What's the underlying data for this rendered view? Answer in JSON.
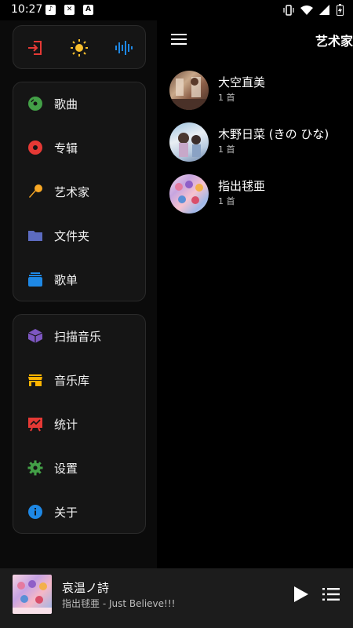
{
  "status_bar": {
    "time": "10:27",
    "left_icons": [
      "music-app-icon",
      "shield-icon",
      "alert-icon"
    ],
    "right_icons": [
      "vibrate-icon",
      "wifi-icon",
      "signal-icon",
      "battery-icon"
    ]
  },
  "drawer": {
    "top_actions": [
      {
        "name": "exit-icon",
        "color": "#e53935"
      },
      {
        "name": "sun-icon",
        "color": "#fbc02d"
      },
      {
        "name": "waveform-icon",
        "color": "#1e88e5"
      }
    ],
    "nav_items": [
      {
        "label": "歌曲",
        "icon": "disc-icon",
        "color": "#43a047"
      },
      {
        "label": "专辑",
        "icon": "album-icon",
        "color": "#e53935"
      },
      {
        "label": "艺术家",
        "icon": "microphone-icon",
        "color": "#f9a825"
      },
      {
        "label": "文件夹",
        "icon": "folder-icon",
        "color": "#5c6bc0"
      },
      {
        "label": "歌单",
        "icon": "playlist-stack-icon",
        "color": "#1e88e5"
      }
    ],
    "tool_items": [
      {
        "label": "扫描音乐",
        "icon": "scan-cube-icon",
        "color": "#7e57c2"
      },
      {
        "label": "音乐库",
        "icon": "store-icon",
        "color": "#ffb300"
      },
      {
        "label": "统计",
        "icon": "chart-board-icon",
        "color": "#e53935"
      },
      {
        "label": "设置",
        "icon": "gear-icon",
        "color": "#43a047"
      },
      {
        "label": "关于",
        "icon": "info-icon",
        "color": "#1e88e5"
      }
    ]
  },
  "main": {
    "title": "艺术家",
    "artists": [
      {
        "name": "大空直美",
        "count": "1 首"
      },
      {
        "name": "木野日菜 (きの ひな)",
        "count": "1 首"
      },
      {
        "name": "指出毬亜",
        "count": "1 首"
      }
    ]
  },
  "player": {
    "title": "哀温ノ詩",
    "subtitle": "指出毬亜 - Just Believe!!!"
  }
}
